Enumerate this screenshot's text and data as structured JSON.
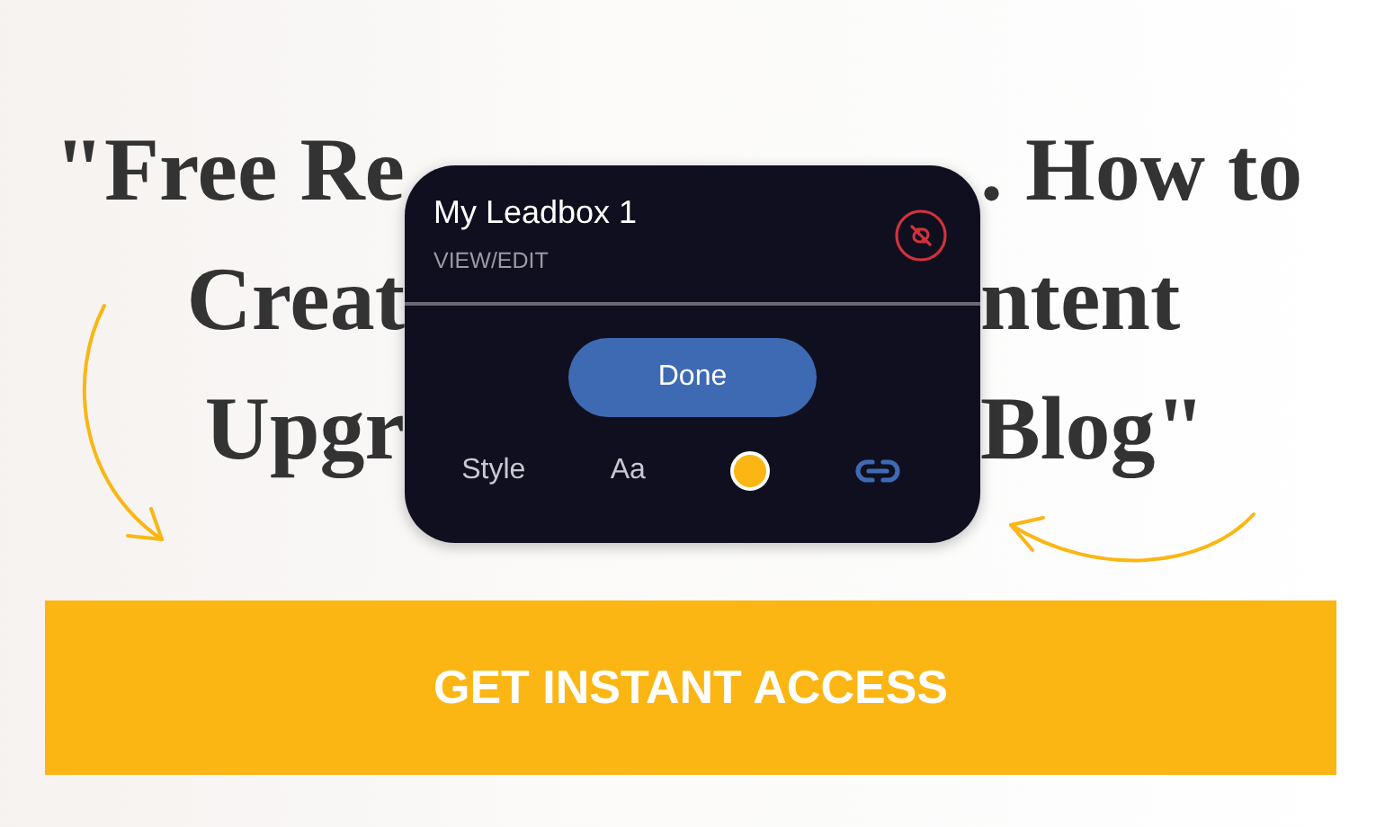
{
  "headline": {
    "lines": [
      {
        "left": "\"Free Re",
        "right": ". How to"
      },
      {
        "left": "Creat",
        "right": "ntent"
      },
      {
        "left": "Upgr",
        "right": "Blog\""
      }
    ]
  },
  "popup": {
    "title": "My Leadbox 1",
    "subtitle": "VIEW/EDIT",
    "done_button": "Done",
    "toolbar": [
      {
        "kind": "text",
        "label": "Style"
      },
      {
        "kind": "text",
        "label": "Aa"
      },
      {
        "kind": "color",
        "color": "#fbb614"
      },
      {
        "kind": "link"
      }
    ]
  },
  "cta_button": "GET INSTANT ACCESS"
}
